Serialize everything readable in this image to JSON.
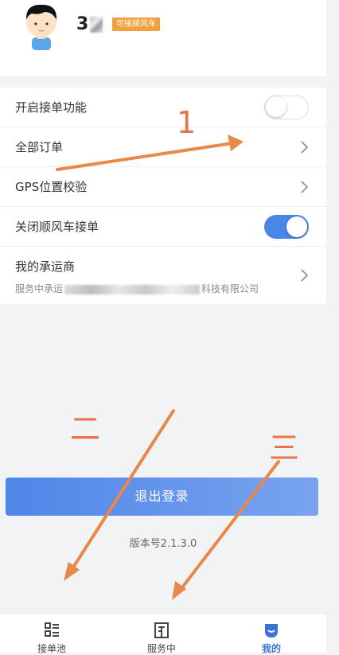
{
  "profile": {
    "name_visible": "3",
    "badge": "可接顺风车"
  },
  "menu": {
    "items": [
      {
        "label": "开启接单功能",
        "control": "toggle",
        "state": "off"
      },
      {
        "label": "全部订单",
        "control": "chevron"
      },
      {
        "label": "GPS位置校验",
        "control": "chevron"
      },
      {
        "label": "关闭顺风车接单",
        "control": "toggle",
        "state": "on"
      },
      {
        "label": "我的承运商",
        "sub_prefix": "服务中承运",
        "sub_suffix": "科技有限公司",
        "control": "chevron"
      }
    ]
  },
  "logout_label": "退出登录",
  "version": "版本号2.1.3.0",
  "tabs": [
    {
      "label": "接单池",
      "icon": "order-pool-icon"
    },
    {
      "label": "服务中",
      "icon": "in-service-icon"
    },
    {
      "label": "我的",
      "icon": "mine-face-icon",
      "active": true
    }
  ],
  "annotations": {
    "one": "1",
    "two": "二",
    "three": "三"
  },
  "colors": {
    "accent": "#4a86e8",
    "badge": "#f0a13c",
    "annotation": "#e8724a"
  }
}
